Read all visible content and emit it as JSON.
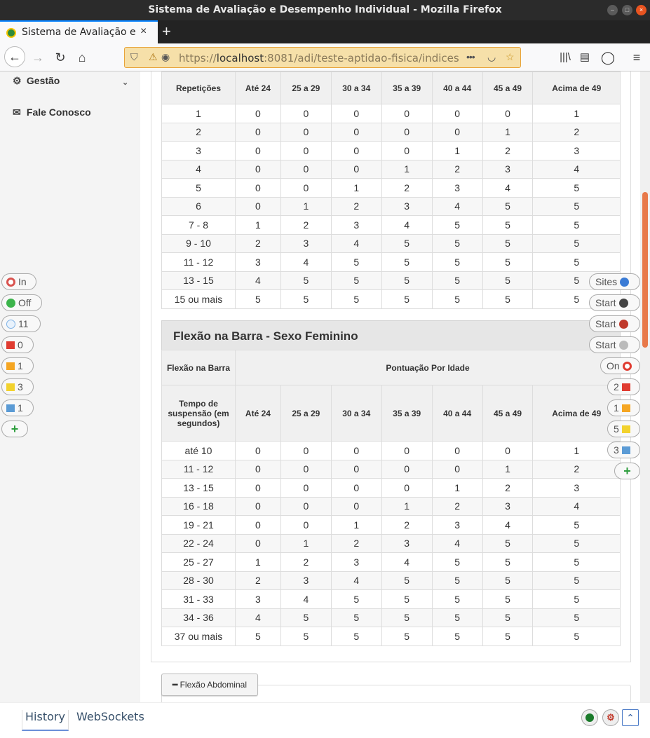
{
  "window": {
    "title": "Sistema de Avaliação e Desempenho Individual - Mozilla Firefox"
  },
  "tab": {
    "title": "Sistema de Avaliação e Desempenho Individual",
    "close": "×",
    "new_tab": "+"
  },
  "navbar": {
    "url_prefix": "https://",
    "url_host": "localhost",
    "url_rest": ":8081/adi/teste-aptidao-fisica/indices",
    "more": "•••"
  },
  "sidebar": {
    "items": [
      {
        "label": "Gestão",
        "icon": "gears-icon"
      },
      {
        "label": "Fale Conosco",
        "icon": "envelope-icon"
      }
    ]
  },
  "hud_left": [
    {
      "label": "In",
      "icon": "target-icon",
      "color": "#d9534f"
    },
    {
      "label": "Off",
      "icon": "green-dot-icon",
      "color": "#3cb44b"
    },
    {
      "label": "11",
      "icon": "bulb-icon",
      "color": "#7fb3e6"
    },
    {
      "label": "0",
      "icon": "red-flag-icon",
      "color": "#e03c31"
    },
    {
      "label": "1",
      "icon": "orange-flag-icon",
      "color": "#f5a623"
    },
    {
      "label": "3",
      "icon": "yellow-flag-icon",
      "color": "#f2d22e"
    },
    {
      "label": "1",
      "icon": "blue-flag-icon",
      "color": "#5b9bd5"
    },
    {
      "label": "+",
      "icon": "plus-icon",
      "color": "#2e9e3e"
    }
  ],
  "hud_right": [
    {
      "label": "Sites",
      "icon": "globe-icon",
      "color": "#3a7bd5"
    },
    {
      "label": "Start",
      "icon": "spider-icon",
      "color": "#444"
    },
    {
      "label": "Start",
      "icon": "spider-red-icon",
      "color": "#c0392b"
    },
    {
      "label": "Start",
      "icon": "flame-icon",
      "color": "#888"
    },
    {
      "label": "On",
      "icon": "crosshair-icon",
      "color": "#e03c31"
    },
    {
      "label": "2",
      "icon": "red-flag-icon",
      "color": "#e03c31"
    },
    {
      "label": "1",
      "icon": "orange-flag-icon",
      "color": "#f5a623"
    },
    {
      "label": "5",
      "icon": "yellow-flag-icon",
      "color": "#f2d22e"
    },
    {
      "label": "3",
      "icon": "blue-flag-icon",
      "color": "#5b9bd5"
    },
    {
      "label": "+",
      "icon": "plus-icon",
      "color": "#2e9e3e"
    }
  ],
  "table1": {
    "headers": [
      "Repetições",
      "Até 24",
      "25 a 29",
      "30 a 34",
      "35 a 39",
      "40 a 44",
      "45 a 49",
      "Acima de 49"
    ],
    "rows": [
      [
        "1",
        "0",
        "0",
        "0",
        "0",
        "0",
        "0",
        "1"
      ],
      [
        "2",
        "0",
        "0",
        "0",
        "0",
        "0",
        "1",
        "2"
      ],
      [
        "3",
        "0",
        "0",
        "0",
        "0",
        "1",
        "2",
        "3"
      ],
      [
        "4",
        "0",
        "0",
        "0",
        "1",
        "2",
        "3",
        "4"
      ],
      [
        "5",
        "0",
        "0",
        "1",
        "2",
        "3",
        "4",
        "5"
      ],
      [
        "6",
        "0",
        "1",
        "2",
        "3",
        "4",
        "5",
        "5"
      ],
      [
        "7 - 8",
        "1",
        "2",
        "3",
        "4",
        "5",
        "5",
        "5"
      ],
      [
        "9 - 10",
        "2",
        "3",
        "4",
        "5",
        "5",
        "5",
        "5"
      ],
      [
        "11 - 12",
        "3",
        "4",
        "5",
        "5",
        "5",
        "5",
        "5"
      ],
      [
        "13 - 15",
        "4",
        "5",
        "5",
        "5",
        "5",
        "5",
        "5"
      ],
      [
        "15 ou mais",
        "5",
        "5",
        "5",
        "5",
        "5",
        "5",
        "5"
      ]
    ]
  },
  "section2": {
    "title": "Flexão na Barra - Sexo Feminino",
    "first_header": "Flexão na Barra",
    "group_header": "Pontuação Por Idade",
    "headers": [
      "Tempo de suspensão (em segundos)",
      "Até 24",
      "25 a 29",
      "30 a 34",
      "35 a 39",
      "40 a 44",
      "45 a 49",
      "Acima de 49"
    ],
    "rows": [
      [
        "até 10",
        "0",
        "0",
        "0",
        "0",
        "0",
        "0",
        "1"
      ],
      [
        "11 - 12",
        "0",
        "0",
        "0",
        "0",
        "0",
        "1",
        "2"
      ],
      [
        "13 - 15",
        "0",
        "0",
        "0",
        "0",
        "1",
        "2",
        "3"
      ],
      [
        "16 - 18",
        "0",
        "0",
        "0",
        "1",
        "2",
        "3",
        "4"
      ],
      [
        "19 - 21",
        "0",
        "0",
        "1",
        "2",
        "3",
        "4",
        "5"
      ],
      [
        "22 - 24",
        "0",
        "1",
        "2",
        "3",
        "4",
        "5",
        "5"
      ],
      [
        "25 - 27",
        "1",
        "2",
        "3",
        "4",
        "5",
        "5",
        "5"
      ],
      [
        "28 - 30",
        "2",
        "3",
        "4",
        "5",
        "5",
        "5",
        "5"
      ],
      [
        "31 - 33",
        "3",
        "4",
        "5",
        "5",
        "5",
        "5",
        "5"
      ],
      [
        "34 - 36",
        "4",
        "5",
        "5",
        "5",
        "5",
        "5",
        "5"
      ],
      [
        "37 ou mais",
        "5",
        "5",
        "5",
        "5",
        "5",
        "5",
        "5"
      ]
    ]
  },
  "abdominal_button": {
    "label": "Flexão Abdominal"
  },
  "bottombar": {
    "tabs": [
      "History",
      "WebSockets"
    ]
  }
}
